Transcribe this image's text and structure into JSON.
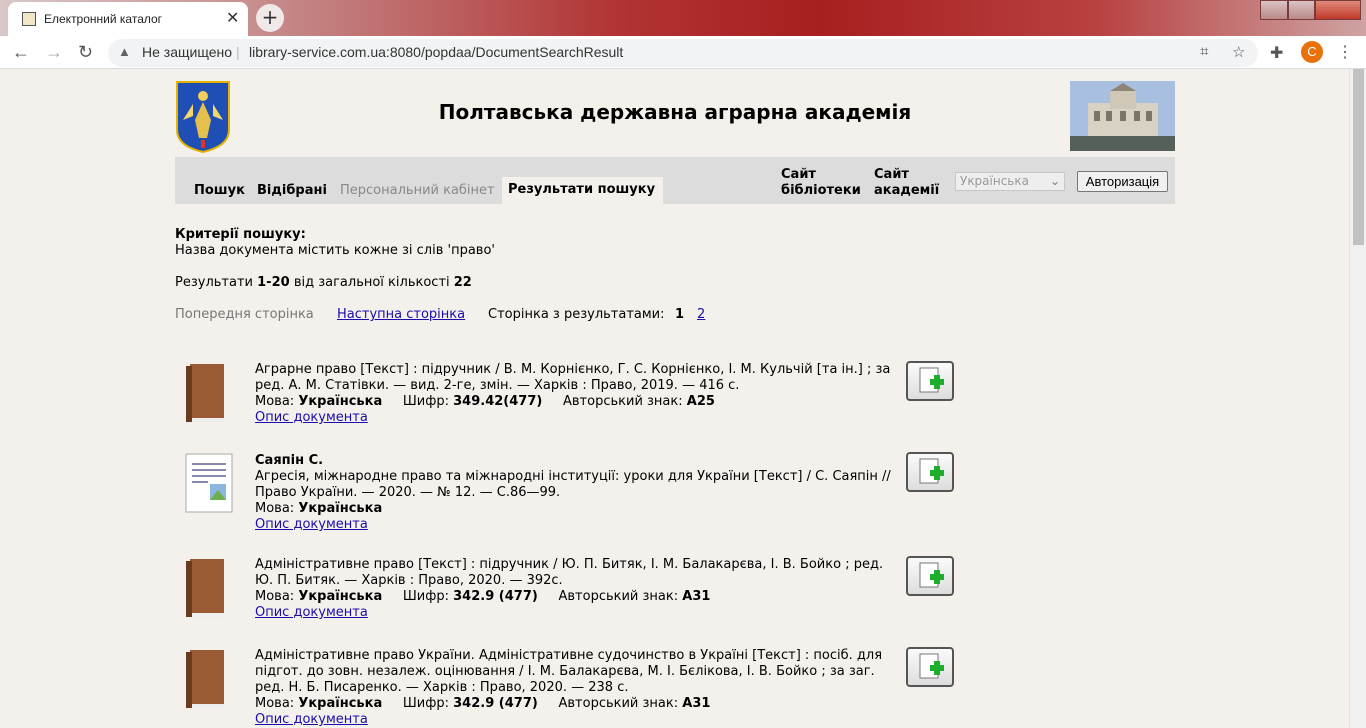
{
  "browser": {
    "tab_title": "Електронний каталог",
    "security": "Не защищено",
    "url": "library-service.com.ua:8080/popdaa/DocumentSearchResult",
    "avatar_letter": "C"
  },
  "header": {
    "title": "Полтавська державна аграрна академія"
  },
  "menu": {
    "search": "Пошук",
    "selected": "Відібрані",
    "cabinet": "Персональний кабінет",
    "results": "Результати пошуку",
    "library_site_1": "Сайт",
    "library_site_2": "бібліотеки",
    "academy_site_1": "Сайт",
    "academy_site_2": "академії",
    "language": "Українська",
    "auth": "Авторизація"
  },
  "criteria": {
    "heading": "Критерії пошуку:",
    "text": "Назва документа містить кожне зі слів 'право'"
  },
  "summary": {
    "prefix": "Результати",
    "range": "1-20",
    "middle": "від загальної кількості",
    "total": "22"
  },
  "pager": {
    "prev": "Попередня сторінка",
    "next": "Наступна сторінка",
    "label": "Сторінка з результатами:",
    "current": "1",
    "other": "2"
  },
  "labels": {
    "lang": "Мова:",
    "cipher": "Шифр:",
    "author_sign": "Авторський знак:",
    "describe": "Опис документа"
  },
  "records": [
    {
      "text": "Аграрне право [Текст] : підручник / В. М. Корнієнко, Г. С. Корнієнко, І. М. Кульчій [та ін.] ; за ред. А. М. Статівки. — вид. 2-ге, змін. — Харків : Право, 2019. — 416 с.",
      "lang": "Українська",
      "cipher": "349.42(477)",
      "sign": "А25"
    },
    {
      "author": "Саяпін С.",
      "text": "Агресія, міжнародне право та міжнародні інституції: уроки для України [Текст] / С. Саяпін // Право України. — 2020. — № 12. — С.86—99.",
      "lang": "Українська"
    },
    {
      "text": "Адміністративне право [Текст] : підручник / Ю. П. Битяк, І. М. Балакарєва, І. В. Бойко ; ред. Ю. П. Битяк. — Харків : Право, 2020. — 392с.",
      "lang": "Українська",
      "cipher": "342.9 (477)",
      "sign": "А31"
    },
    {
      "text": "Адміністративне право України. Адміністративне судочинство в Україні [Текст] : посіб. для підгот. до зовн. незалеж. оцінювання / І. М. Балакарєва, М. І. Бєлікова, І. В. Бойко ; за заг. ред. Н. Б. Писаренко. — Харків : Право, 2020. — 238 с.",
      "lang": "Українська",
      "cipher": "342.9 (477)",
      "sign": "А31"
    }
  ]
}
